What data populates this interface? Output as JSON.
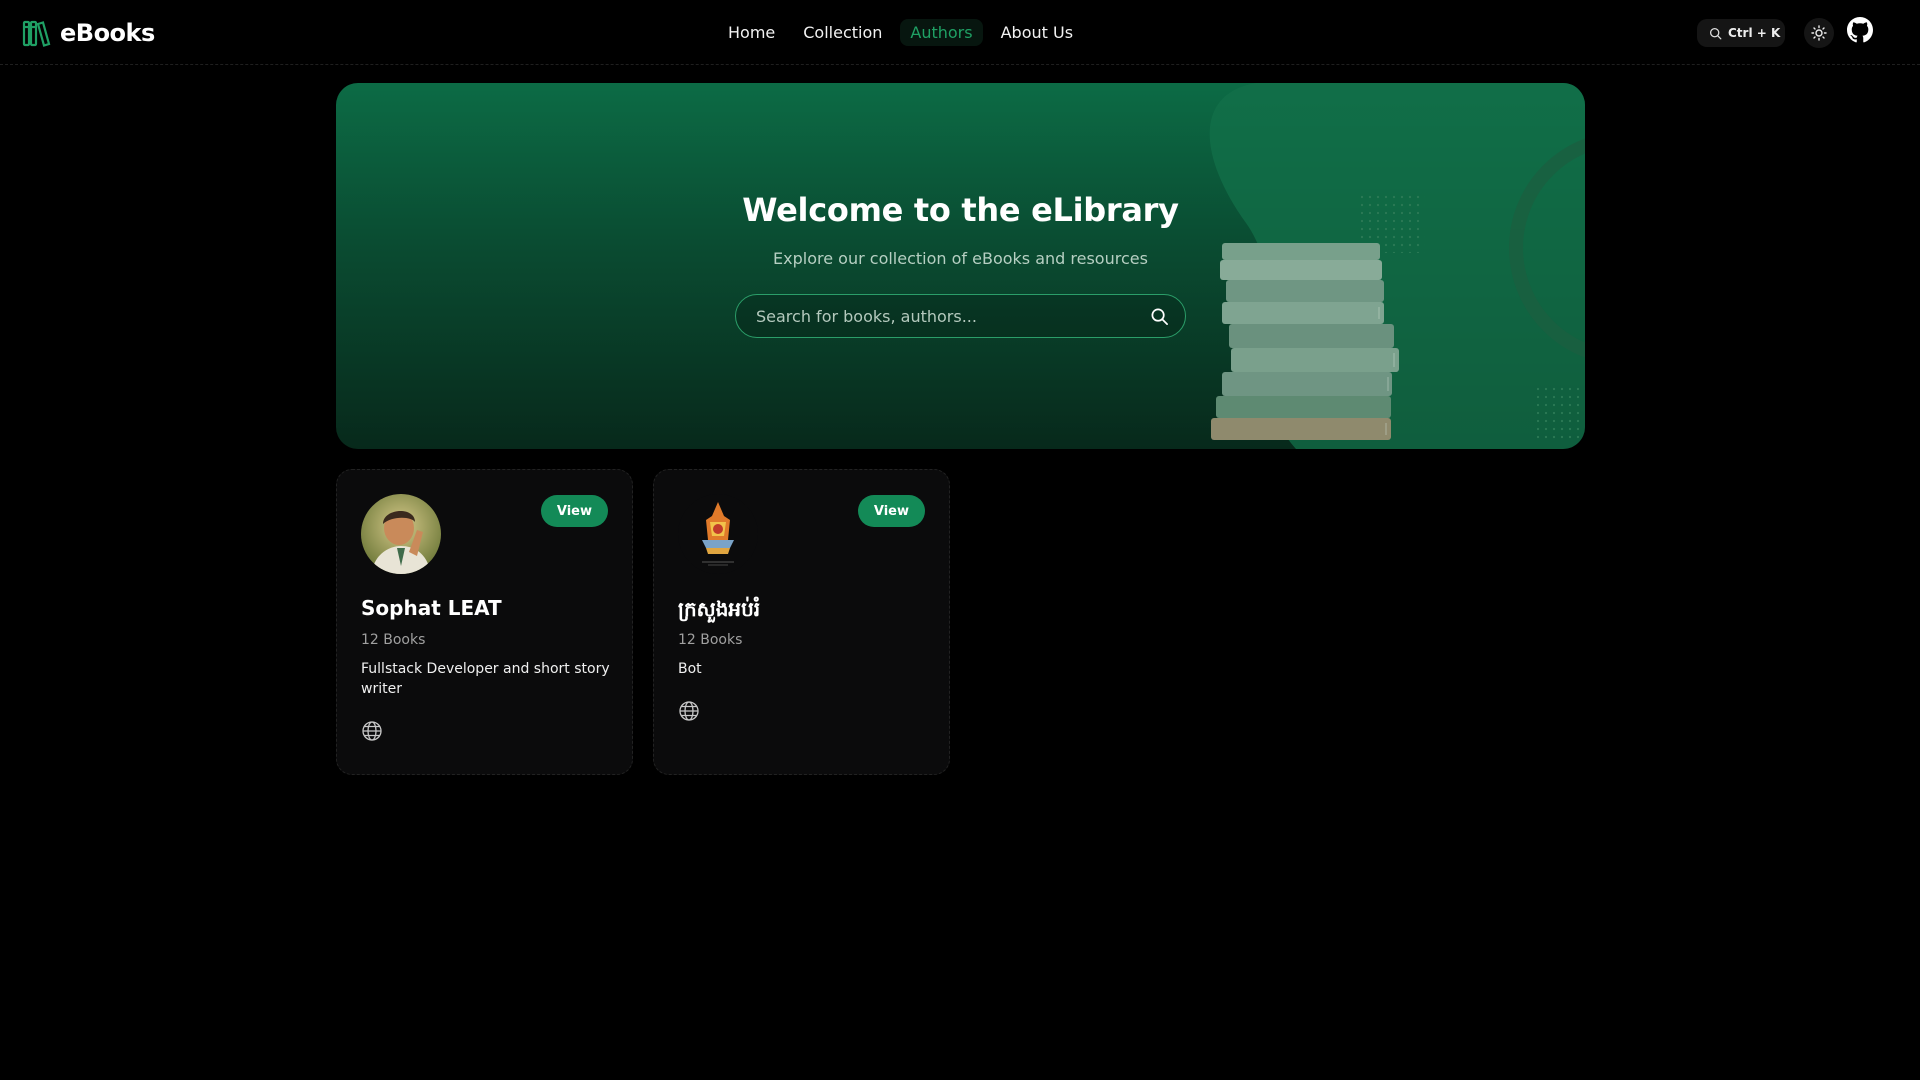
{
  "header": {
    "brand": "eBooks",
    "nav": [
      {
        "label": "Home"
      },
      {
        "label": "Collection"
      },
      {
        "label": "Authors",
        "active": true
      },
      {
        "label": "About Us"
      }
    ],
    "search_shortcut": "Ctrl + K"
  },
  "hero": {
    "title": "Welcome to the eLibrary",
    "subtitle": "Explore our collection of eBooks and resources",
    "search_placeholder": "Search for books, authors..."
  },
  "authors": [
    {
      "name": "Sophat LEAT",
      "count": "12 Books",
      "bio": "Fullstack Developer and short story writer",
      "button": "View"
    },
    {
      "name": "ក្រសួងអប់រំ",
      "count": "12 Books",
      "bio": "Bot",
      "button": "View"
    }
  ],
  "colors": {
    "accent": "#138a57",
    "nav_active": "#1fa064",
    "hero_top": "#0c6b45",
    "hero_bottom": "#07291b",
    "background": "#000000",
    "card": "#0b0b0c"
  },
  "icons": [
    "books-logo-icon",
    "search-icon",
    "sun-icon",
    "github-icon",
    "globe-icon"
  ]
}
